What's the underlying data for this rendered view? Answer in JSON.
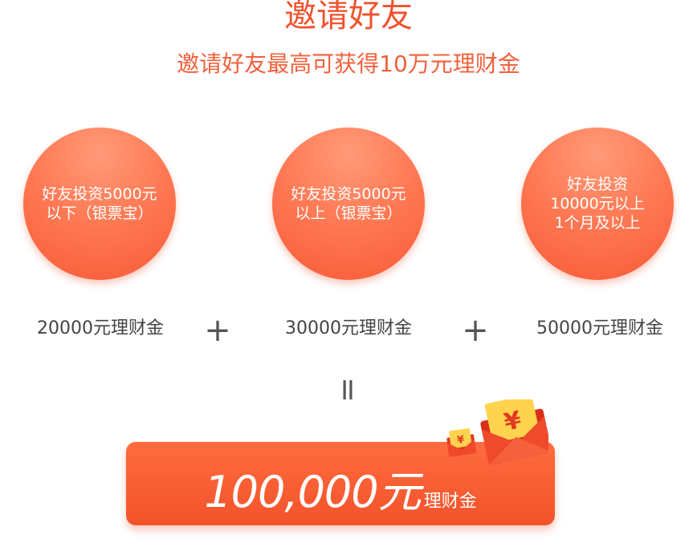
{
  "header": {
    "title": "邀请好友",
    "subtitle": "邀请好友最高可获得10万元理财金"
  },
  "tiers": [
    {
      "condition": "好友投资5000元\n以下（银票宝）",
      "reward": "20000元理财金"
    },
    {
      "condition": "好友投资5000元\n以上（银票宝）",
      "reward": "30000元理财金"
    },
    {
      "condition": "好友投资\n10000元以上\n1个月及以上",
      "reward": "50000元理财金"
    }
  ],
  "operators": {
    "plus": "+",
    "equals": "="
  },
  "total": {
    "value": "100,000元",
    "unit": "理财金"
  },
  "icons": {
    "decoration": "red-envelope-yen-icon"
  },
  "colors": {
    "accent": "#f0522e",
    "circle": "#ff7a55",
    "total_bg": "#f75a36"
  }
}
